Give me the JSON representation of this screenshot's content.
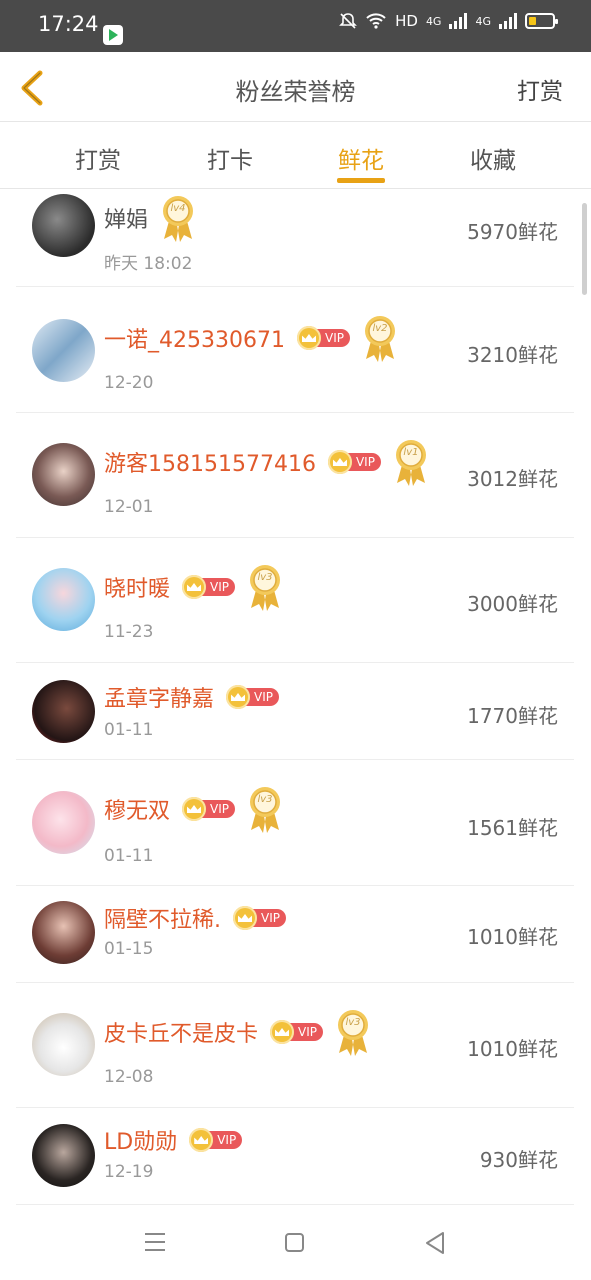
{
  "status_bar": {
    "time": "17:24",
    "network": "HD",
    "net1": "4G",
    "net2": "4G"
  },
  "header": {
    "title": "粉丝荣誉榜",
    "right_action": "打赏"
  },
  "tabs": [
    {
      "label": "打赏",
      "active": false
    },
    {
      "label": "打卡",
      "active": false
    },
    {
      "label": "鲜花",
      "active": true
    },
    {
      "label": "收藏",
      "active": false
    }
  ],
  "fans": [
    {
      "name": "婵娟",
      "vip": false,
      "level": "lv4",
      "date": "昨天 18:02",
      "flowers": "5970鲜花"
    },
    {
      "name": "一诺_425330671",
      "vip": true,
      "vip_label": "VIP",
      "level": "lv2",
      "date": "12-20",
      "flowers": "3210鲜花"
    },
    {
      "name": "游客158151577416",
      "vip": true,
      "vip_label": "VIP",
      "level": "lv1",
      "date": "12-01",
      "flowers": "3012鲜花"
    },
    {
      "name": "晓时暖",
      "vip": true,
      "vip_label": "VIP",
      "level": "lv3",
      "date": "11-23",
      "flowers": "3000鲜花"
    },
    {
      "name": "孟章字静嘉",
      "vip": true,
      "vip_label": "VIP",
      "level": null,
      "date": "01-11",
      "flowers": "1770鲜花"
    },
    {
      "name": "穆无双",
      "vip": true,
      "vip_label": "VIP",
      "level": "lv3",
      "date": "01-11",
      "flowers": "1561鲜花"
    },
    {
      "name": "隔壁不拉稀.",
      "vip": true,
      "vip_label": "VIP",
      "level": null,
      "date": "01-15",
      "flowers": "1010鲜花"
    },
    {
      "name": "皮卡丘不是皮卡",
      "vip": true,
      "vip_label": "VIP",
      "level": "lv3",
      "date": "12-08",
      "flowers": "1010鲜花"
    },
    {
      "name": "LD勋勋",
      "vip": true,
      "vip_label": "VIP",
      "level": null,
      "date": "12-19",
      "flowers": "930鲜花"
    }
  ],
  "colors": {
    "accent": "#e8a215",
    "vip_name": "#e05a2b",
    "vip_badge": "#e9585a"
  }
}
